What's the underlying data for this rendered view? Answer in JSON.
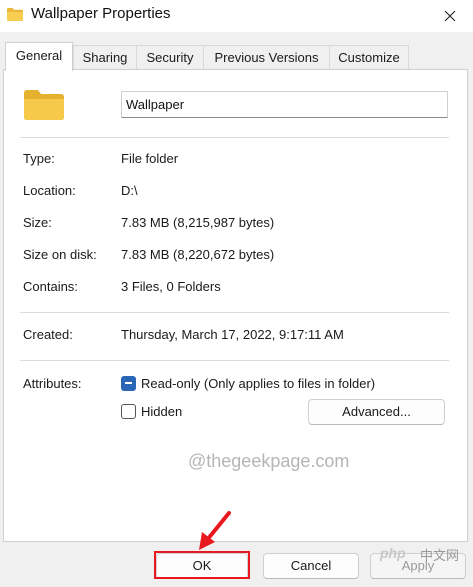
{
  "window": {
    "title": "Wallpaper Properties"
  },
  "tabs": [
    {
      "label": "General",
      "active": true
    },
    {
      "label": "Sharing",
      "active": false
    },
    {
      "label": "Security",
      "active": false
    },
    {
      "label": "Previous Versions",
      "active": false
    },
    {
      "label": "Customize",
      "active": false
    }
  ],
  "general": {
    "name": "Wallpaper",
    "rows": [
      {
        "label": "Type:",
        "value": "File folder"
      },
      {
        "label": "Location:",
        "value": "D:\\"
      },
      {
        "label": "Size:",
        "value": "7.83 MB (8,215,987 bytes)"
      },
      {
        "label": "Size on disk:",
        "value": "7.83 MB (8,220,672 bytes)"
      },
      {
        "label": "Contains:",
        "value": "3 Files, 0 Folders"
      },
      {
        "label": "Created:",
        "value": "Thursday, March 17, 2022, 9:17:11 AM"
      }
    ],
    "attributes_label": "Attributes:",
    "readonly_label": "Read-only (Only applies to files in folder)",
    "readonly_state": "indeterminate",
    "hidden_label": "Hidden",
    "hidden_checked": false,
    "advanced_label": "Advanced..."
  },
  "watermark": "@thegeekpage.com",
  "buttons": {
    "ok": "OK",
    "cancel": "Cancel",
    "apply": "Apply"
  },
  "overlay": {
    "php_text": "php",
    "cn_text": "中文网"
  },
  "colors": {
    "highlight": "#e8181f",
    "accent": "#2b66b6",
    "folder": "#f5c342"
  }
}
